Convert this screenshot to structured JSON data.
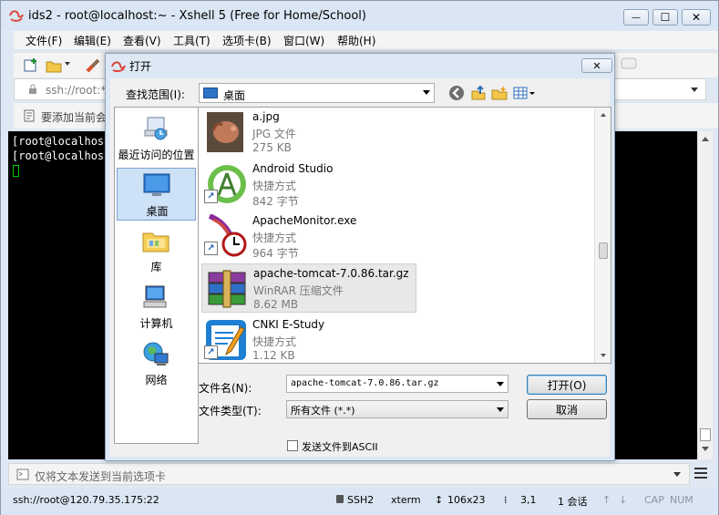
{
  "window": {
    "title": "ids2 - root@localhost:~ - Xshell 5 (Free for Home/School)",
    "minimize_label": "—",
    "maximize_label": "☐",
    "close_label": "✕"
  },
  "menu": [
    "文件(F)",
    "编辑(E)",
    "查看(V)",
    "工具(T)",
    "选项卡(B)",
    "窗口(W)",
    "帮助(H)"
  ],
  "address_bar": {
    "value": "ssh://root:*"
  },
  "hint_bar": {
    "text": "要添加当前会"
  },
  "terminal": {
    "lines": [
      "[root@localhost",
      "[root@localhost"
    ]
  },
  "send_bar": {
    "placeholder": "仅将文本发送到当前选项卡"
  },
  "status_bar": {
    "connection": "ssh://root@120.79.35.175:22",
    "protocol": "SSH2",
    "terminal_type": "xterm",
    "size": "106x23",
    "cursor_pos": "3,1",
    "sessions": "1 会话",
    "caps": "CAP",
    "num": "NUM"
  },
  "dialog": {
    "title": "打开",
    "close_label": "✕",
    "look_in_label": "查找范围(I):",
    "look_in_value": "桌面",
    "places": [
      {
        "label": "最近访问的位置",
        "icon": "recent-places-icon"
      },
      {
        "label": "桌面",
        "icon": "desktop-icon"
      },
      {
        "label": "库",
        "icon": "library-icon"
      },
      {
        "label": "计算机",
        "icon": "computer-icon"
      },
      {
        "label": "网络",
        "icon": "network-icon"
      }
    ],
    "files": [
      {
        "name": "a.jpg",
        "type": "JPG 文件",
        "size": "275 KB"
      },
      {
        "name": "Android Studio",
        "type": "快捷方式",
        "size": "842 字节"
      },
      {
        "name": "ApacheMonitor.exe",
        "type": "快捷方式",
        "size": "964 字节"
      },
      {
        "name": "apache-tomcat-7.0.86.tar.gz",
        "type": "WinRAR 压缩文件",
        "size": "8.62 MB"
      },
      {
        "name": "CNKI E-Study",
        "type": "快捷方式",
        "size": "1.12 KB"
      }
    ],
    "file_name_label": "文件名(N):",
    "file_name_value": "apache-tomcat-7.0.86.tar.gz",
    "file_type_label": "文件类型(T):",
    "file_type_value": "所有文件 (*.*)",
    "open_button": "打开(O)",
    "cancel_button": "取消",
    "ascii_checkbox_label": "发送文件到ASCII"
  },
  "colors": {
    "titlebar": "#dbe6f4",
    "terminal_bg": "#000000",
    "cursor": "#00cc00",
    "selected_place": "#cde1f7"
  }
}
